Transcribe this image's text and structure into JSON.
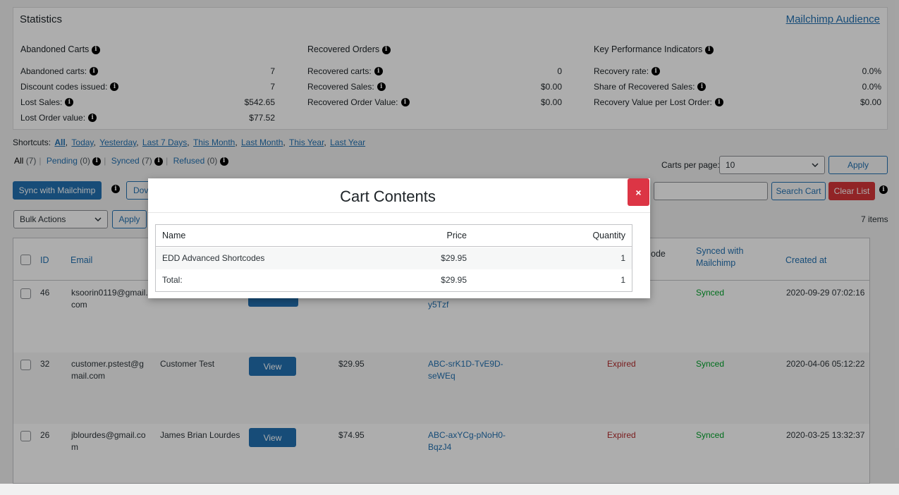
{
  "stats": {
    "title": "Statistics",
    "audience_link": "Mailchimp Audience",
    "abandoned": {
      "heading": "Abandoned Carts",
      "rows": [
        {
          "label": "Abandoned carts:",
          "value": "7"
        },
        {
          "label": "Discount codes issued:",
          "value": "7"
        },
        {
          "label": "Lost Sales:",
          "value": "$542.65"
        },
        {
          "label": "Lost Order value:",
          "value": "$77.52"
        }
      ]
    },
    "recovered": {
      "heading": "Recovered Orders",
      "rows": [
        {
          "label": "Recovered carts:",
          "value": "0"
        },
        {
          "label": "Recovered Sales:",
          "value": "$0.00"
        },
        {
          "label": "Recovered Order Value:",
          "value": "$0.00"
        }
      ]
    },
    "kpi": {
      "heading": "Key Performance Indicators",
      "rows": [
        {
          "label": "Recovery rate:",
          "value": "0.0%"
        },
        {
          "label": "Share of Recovered Sales:",
          "value": "0.0%"
        },
        {
          "label": "Recovery Value per Lost Order:",
          "value": "$0.00"
        }
      ]
    }
  },
  "shortcuts": {
    "label": "Shortcuts:",
    "items": [
      "All",
      "Today",
      "Yesterday",
      "Last 7 Days",
      "This Month",
      "Last Month",
      "This Year",
      "Last Year"
    ]
  },
  "status_filters": {
    "all": "All",
    "all_count": "(7)",
    "pending": "Pending",
    "pending_count": "(0)",
    "synced": "Synced",
    "synced_count": "(7)",
    "refused": "Refused",
    "refused_count": "(0)"
  },
  "toolbar": {
    "carts_per_page_label": "Carts per page:",
    "carts_per_page_value": "10",
    "apply_label": "Apply",
    "sync_label": "Sync with Mailchimp",
    "download_partial": "Dov",
    "search_label": "Search Cart",
    "clear_label": "Clear List",
    "bulk_actions": "Bulk Actions",
    "bulk_apply": "Apply",
    "items_count": "7 items"
  },
  "table": {
    "headers": {
      "id": "ID",
      "email": "Email",
      "code_partial": "ode",
      "synced_line1": "Synced with",
      "synced_line2": "Mailchimp",
      "created": "Created at"
    },
    "rows": [
      {
        "id": "46",
        "email1": "ksoorin0119@gmail.",
        "email2": "com",
        "name": "",
        "amount": "",
        "coupon1": "",
        "coupon2": "y5Tzf",
        "status": "",
        "synced": "Synced",
        "created": "2020-09-29 07:02:16"
      },
      {
        "id": "32",
        "email1": "customer.pstest@g",
        "email2": "mail.com",
        "name": "Customer Test",
        "amount": "$29.95",
        "coupon1": "ABC-srK1D-TvE9D-",
        "coupon2": "seWEq",
        "status": "Expired",
        "synced": "Synced",
        "created": "2020-04-06 05:12:22"
      },
      {
        "id": "26",
        "email1": "jblourdes@gmail.co",
        "email2": "m",
        "name": "James Brian Lourdes",
        "amount": "$74.95",
        "coupon1": "ABC-axYCg-pNoH0-",
        "coupon2": "BqzJ4",
        "status": "Expired",
        "synced": "Synced",
        "created": "2020-03-25 13:32:37"
      }
    ],
    "view_label": "View"
  },
  "modal": {
    "title": "Cart Contents",
    "close": "×",
    "headers": {
      "name": "Name",
      "price": "Price",
      "quantity": "Quantity"
    },
    "item": {
      "name": "EDD Advanced Shortcodes",
      "price": "$29.95",
      "quantity": "1"
    },
    "total": {
      "label": "Total:",
      "price": "$29.95",
      "quantity": "1"
    }
  }
}
